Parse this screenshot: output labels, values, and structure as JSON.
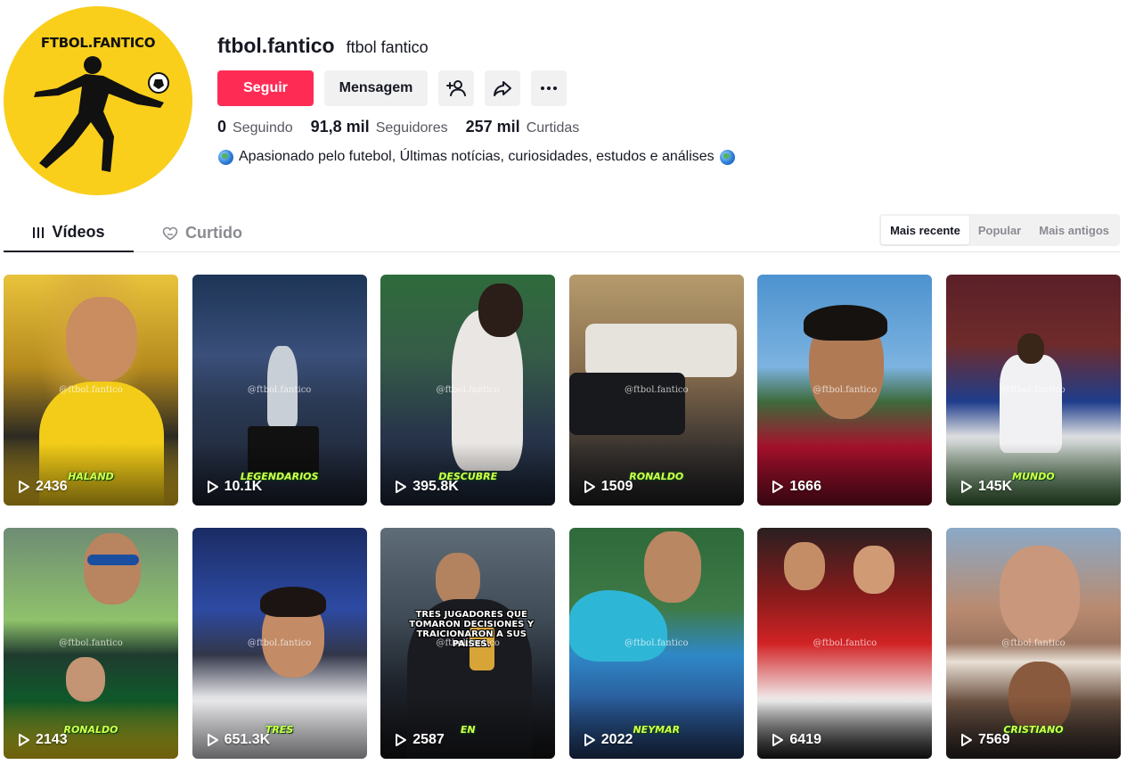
{
  "profile": {
    "avatar_text": "FTBOL.FANTICO",
    "username": "ftbol.fantico",
    "nickname": "ftbol fantico",
    "follow_label": "Seguir",
    "message_label": "Mensagem",
    "stats": [
      {
        "value": "0",
        "label": "Seguindo"
      },
      {
        "value": "91,8 mil",
        "label": "Seguidores"
      },
      {
        "value": "257 mil",
        "label": "Curtidas"
      }
    ],
    "bio": "Apasionado pelo futebol, Últimas notícias, curiosidades, estudos e análises"
  },
  "tabs": {
    "videos": "Vídeos",
    "liked": "Curtido"
  },
  "sort": {
    "options": [
      "Mais recente",
      "Popular",
      "Mais antigos"
    ],
    "active": "Mais recente"
  },
  "icons": {
    "add_friend": "person-plus-icon",
    "share": "share-arrow-icon",
    "more": "ellipsis-icon",
    "videos_tab": "grid-bars-icon",
    "liked_tab": "heart-outline-icon",
    "views": "play-icon"
  },
  "colors": {
    "accent": "#fe2c55",
    "avatar_bg": "#f9cf1c",
    "caption": "#d7ff4a"
  },
  "watermark": "@ftbol.fantico",
  "videos": [
    {
      "views": "2436",
      "caption": "HALAND",
      "overlay": ""
    },
    {
      "views": "10.1K",
      "caption": "LEGENDARIOS",
      "overlay": ""
    },
    {
      "views": "395.8K",
      "caption": "DESCUBRE",
      "overlay": ""
    },
    {
      "views": "1509",
      "caption": "RONALDO",
      "overlay": ""
    },
    {
      "views": "1666",
      "caption": "",
      "overlay": ""
    },
    {
      "views": "145K",
      "caption": "MUNDO",
      "overlay": ""
    },
    {
      "views": "2143",
      "caption": "RONALDO",
      "overlay": ""
    },
    {
      "views": "651.3K",
      "caption": "TRES",
      "overlay": ""
    },
    {
      "views": "2587",
      "caption": "EN",
      "overlay": "TRES JUGADORES QUE TOMARON DECISIONES Y TRAICIONARON A SUS PAÍSES."
    },
    {
      "views": "2022",
      "caption": "NEYMAR",
      "overlay": ""
    },
    {
      "views": "6419",
      "caption": "",
      "overlay": ""
    },
    {
      "views": "7569",
      "caption": "CRISTIANO",
      "overlay": ""
    }
  ]
}
